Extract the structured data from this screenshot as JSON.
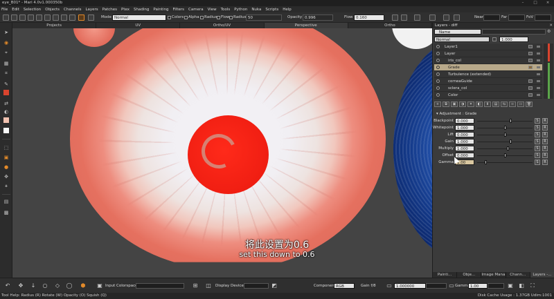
{
  "window": {
    "title": "eye_B01* - Mari 4.0v1.000350b"
  },
  "menu": [
    "File",
    "Edit",
    "Selection",
    "Objects",
    "Channels",
    "Layers",
    "Patches",
    "Ptex",
    "Shading",
    "Painting",
    "Filters",
    "Camera",
    "View",
    "Tools",
    "Python",
    "Nuka",
    "Scripts",
    "Help"
  ],
  "toolbar": {
    "mode_label": "Mode",
    "mode_value": "Normal",
    "colors_label": "Colors",
    "alpha_label": "Alpha",
    "radius_label": "Radius",
    "flow_label": "Flow",
    "radius2_label": "Radius",
    "radius_value": "50",
    "opacity_label": "Opacity",
    "opacity_value": "0.996",
    "flow2_label": "Flow",
    "flow_value": "0.160",
    "near_label": "Near",
    "far_label": "Far",
    "fov_label": "FoV"
  },
  "view_tabs": [
    "Projects",
    "UV",
    "Ortho/UV",
    "Perspective",
    "Ortho"
  ],
  "subtitles": {
    "chinese": "将此设置为0.6",
    "english": "set this down to 0.6"
  },
  "layers_panel": {
    "title": "Layers - diff",
    "name_filter": "Name",
    "blend_mode": "Normal",
    "opacity": "1.000",
    "layers": [
      {
        "name": "Layer1",
        "indent": 1,
        "selected": false
      },
      {
        "name": "Layer",
        "indent": 1,
        "selected": false
      },
      {
        "name": "iris_col",
        "indent": 2,
        "selected": false
      },
      {
        "name": "Grade",
        "indent": 2,
        "selected": true
      },
      {
        "name": "Turbulence (extended)",
        "indent": 2,
        "selected": false
      },
      {
        "name": "corneaGuide",
        "indent": 2,
        "selected": false
      },
      {
        "name": "sclera_col",
        "indent": 2,
        "selected": false
      },
      {
        "name": "Color",
        "indent": 2,
        "selected": false
      }
    ],
    "adjustment_title": "Adjustment : Grade",
    "params": [
      {
        "label": "Blackpoint",
        "value": "0.000",
        "knob": 0.6
      },
      {
        "label": "Whitepoint",
        "value": "1.000",
        "knob": 0.5
      },
      {
        "label": "Lift",
        "value": "0.000",
        "knob": 0.5
      },
      {
        "label": "Gain",
        "value": "1.000",
        "knob": 0.6
      },
      {
        "label": "Multiply",
        "value": "1.000",
        "knob": 0.55
      },
      {
        "label": "Offset",
        "value": "0.000",
        "knob": 0.5
      },
      {
        "label": "Gamma",
        "value": "1.00",
        "knob": 0.14
      }
    ],
    "tabs": [
      "Painti...",
      "Obje...",
      "Image Mana...",
      "Chann...",
      "Layers -..."
    ]
  },
  "bottom": {
    "input_colorspace_label": "Input Colorspace",
    "display_device_label": "Display Device",
    "component_label": "Component",
    "component_value": "RGB",
    "gain_label": "Gain f/8",
    "gain_value": "1.000000",
    "gamma_label": "Gamma",
    "gamma_value": "1.00"
  },
  "status": {
    "left": "Tool Help:   Radius (R)   Rotate (W)   Opacity (O)   Squish (Q)",
    "right": "Disk Cache Usage : 1.37GB  Udim:1001"
  }
}
